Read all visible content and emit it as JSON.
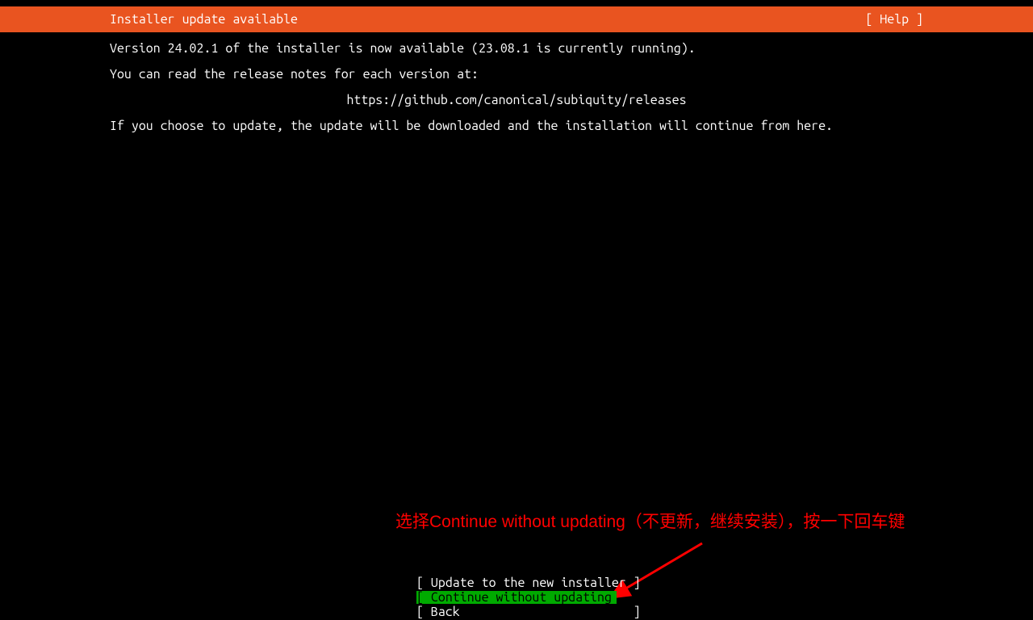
{
  "header": {
    "title": "Installer update available",
    "help": "[ Help ]"
  },
  "body": {
    "line1": "Version 24.02.1 of the installer is now available (23.08.1 is currently running).",
    "line2": "You can read the release notes for each version at:",
    "url": "https://github.com/canonical/subiquity/releases",
    "line3": "If you choose to update, the update will be downloaded and the installation will continue from here."
  },
  "annotation": "选择Continue without updating（不更新，继续安装），按一下回车键",
  "buttons": {
    "update": "[ Update to the new installer ]",
    "continue": "[ Continue without updating   ]",
    "back": "[ Back                        ]"
  }
}
